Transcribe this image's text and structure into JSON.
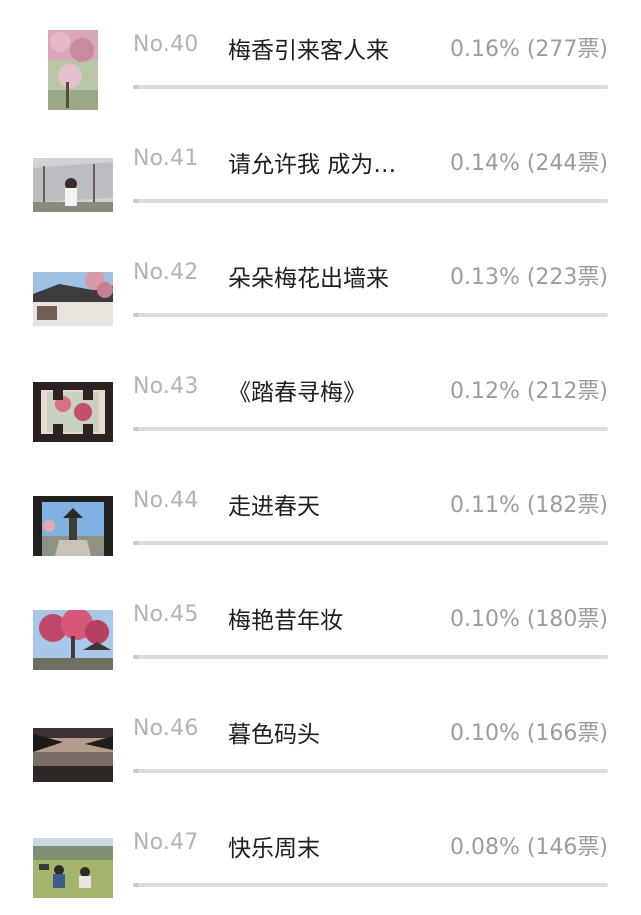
{
  "entries": [
    {
      "rank": "No.40",
      "title": "梅香引来客人来",
      "votes": "0.16% (277票)",
      "percent": 0.16,
      "thumb": "plum-garden-photo"
    },
    {
      "rank": "No.41",
      "title": "请允许我 成为…",
      "votes": "0.14% (244票)",
      "percent": 0.14,
      "thumb": "woman-under-plum-tree-photo"
    },
    {
      "rank": "No.42",
      "title": "朵朵梅花出墙来",
      "votes": "0.13% (223票)",
      "percent": 0.13,
      "thumb": "plum-over-wall-photo"
    },
    {
      "rank": "No.43",
      "title": "《踏春寻梅》",
      "votes": "0.12% (212票)",
      "percent": 0.12,
      "thumb": "lattice-window-photo"
    },
    {
      "rank": "No.44",
      "title": "走进春天",
      "votes": "0.11% (182票)",
      "percent": 0.11,
      "thumb": "pavilion-through-gate-photo"
    },
    {
      "rank": "No.45",
      "title": "梅艳昔年妆",
      "votes": "0.10% (180票)",
      "percent": 0.1,
      "thumb": "pink-plum-tree-photo"
    },
    {
      "rank": "No.46",
      "title": "暮色码头",
      "votes": "0.10% (166票)",
      "percent": 0.1,
      "thumb": "dusk-dock-photo"
    },
    {
      "rank": "No.47",
      "title": "快乐周末",
      "votes": "0.08% (146票)",
      "percent": 0.08,
      "thumb": "family-picnic-photo"
    }
  ]
}
